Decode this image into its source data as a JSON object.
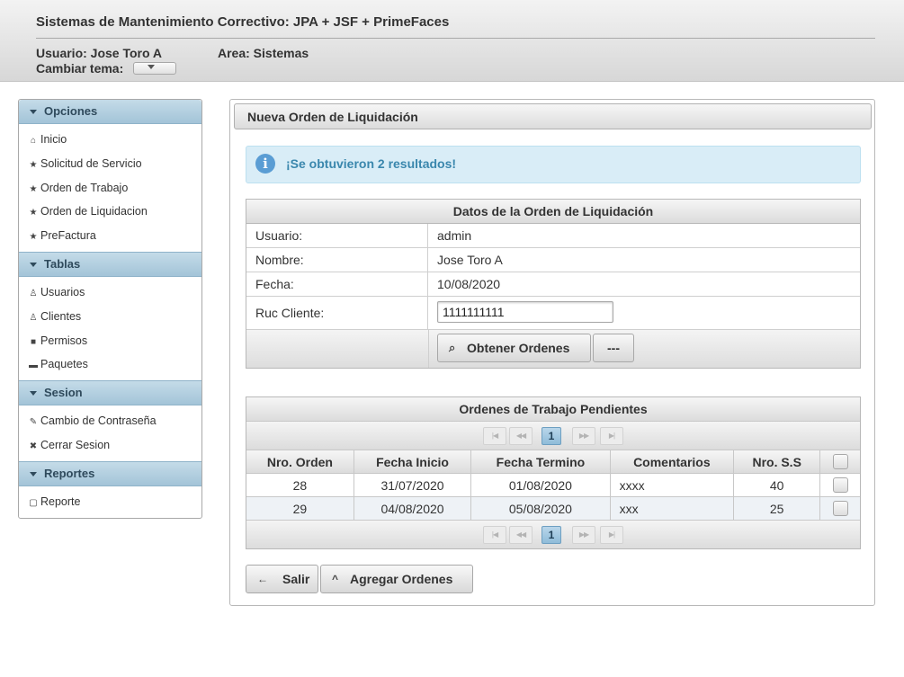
{
  "header": {
    "title": "Sistemas de Mantenimiento Correctivo: JPA + JSF + PrimeFaces",
    "user": "Usuario: Jose Toro A",
    "area": "Area: Sistemas",
    "theme_label": "Cambiar tema:"
  },
  "sidebar": {
    "sections": [
      {
        "title": "Opciones",
        "items": [
          {
            "icon": "home-icon",
            "glyph": "⌂",
            "label": "Inicio"
          },
          {
            "icon": "star-icon",
            "glyph": "★",
            "label": "Solicitud de Servicio"
          },
          {
            "icon": "star-icon",
            "glyph": "★",
            "label": "Orden de Trabajo"
          },
          {
            "icon": "star-icon",
            "glyph": "★",
            "label": "Orden de Liquidacion"
          },
          {
            "icon": "star-icon",
            "glyph": "★",
            "label": "PreFactura"
          }
        ]
      },
      {
        "title": "Tablas",
        "items": [
          {
            "icon": "person-icon",
            "glyph": "♙",
            "label": "Usuarios"
          },
          {
            "icon": "person-icon",
            "glyph": "♙",
            "label": "Clientes"
          },
          {
            "icon": "lock-icon",
            "glyph": "■",
            "label": "Permisos"
          },
          {
            "icon": "folder-icon",
            "glyph": "▬",
            "label": "Paquetes"
          }
        ]
      },
      {
        "title": "Sesion",
        "items": [
          {
            "icon": "wrench-icon",
            "glyph": "✎",
            "label": "Cambio de Contraseña"
          },
          {
            "icon": "close-icon",
            "glyph": "✖",
            "label": "Cerrar Sesion"
          }
        ]
      },
      {
        "title": "Reportes",
        "items": [
          {
            "icon": "document-icon",
            "glyph": "▢",
            "label": "Reporte"
          }
        ]
      }
    ]
  },
  "panel": {
    "title": "Nueva Orden de Liquidación",
    "message": "¡Se obtuvieron 2 resultados!",
    "form": {
      "title": "Datos de la Orden de Liquidación",
      "usuario_label": "Usuario:",
      "usuario_value": "admin",
      "nombre_label": "Nombre:",
      "nombre_value": "Jose Toro A",
      "fecha_label": "Fecha:",
      "fecha_value": "10/08/2020",
      "ruc_label": "Ruc Cliente:",
      "ruc_value": "1111111111",
      "obtener_label": "Obtener Ordenes",
      "reset_label": "---"
    },
    "ordenes": {
      "title": "Ordenes de Trabajo Pendientes",
      "page": "1",
      "columns": [
        "Nro. Orden",
        "Fecha Inicio",
        "Fecha Termino",
        "Comentarios",
        "Nro. S.S"
      ],
      "rows": [
        {
          "nro": "28",
          "inicio": "31/07/2020",
          "termino": "01/08/2020",
          "comentarios": "xxxx",
          "ss": "40"
        },
        {
          "nro": "29",
          "inicio": "04/08/2020",
          "termino": "05/08/2020",
          "comentarios": "xxx",
          "ss": "25"
        }
      ]
    },
    "salir_label": "Salir",
    "agregar_label": "Agregar Ordenes"
  },
  "colors": {
    "accent": "#a3c4d8",
    "info_bg": "#d9edf7",
    "info_text": "#3a87ad",
    "active_page": "#8fbcd9"
  }
}
